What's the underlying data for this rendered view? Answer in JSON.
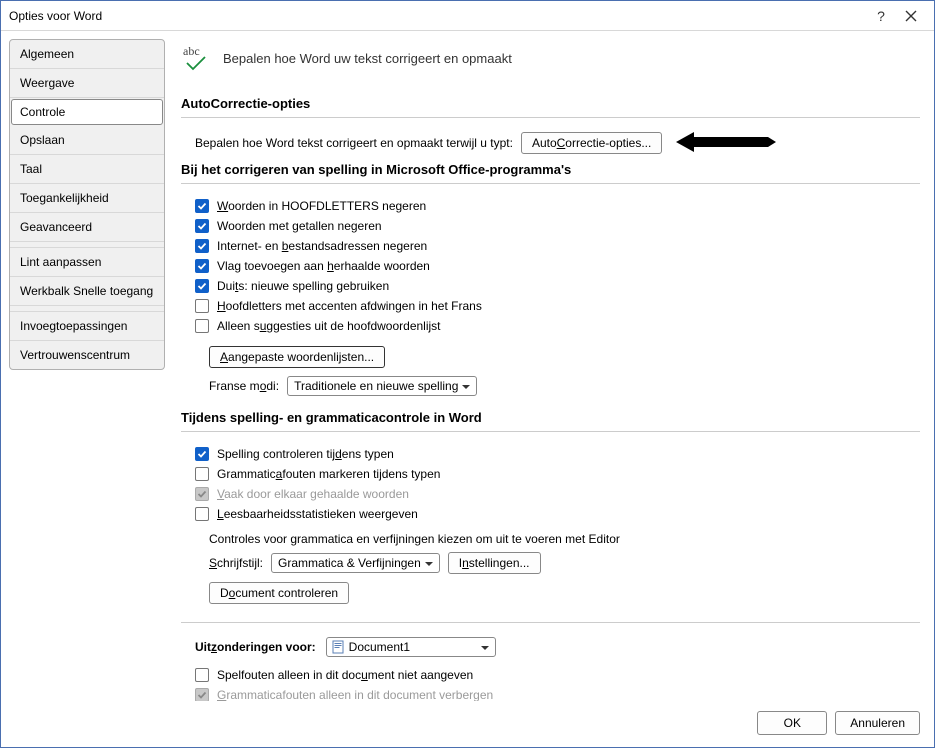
{
  "titlebar": {
    "title": "Opties voor Word"
  },
  "sidebar": {
    "items": [
      {
        "label": "Algemeen"
      },
      {
        "label": "Weergave"
      },
      {
        "label": "Controle",
        "selected": true
      },
      {
        "label": "Opslaan"
      },
      {
        "label": "Taal"
      },
      {
        "label": "Toegankelijkheid"
      },
      {
        "label": "Geavanceerd"
      },
      {
        "separator": true
      },
      {
        "label": "Lint aanpassen"
      },
      {
        "label": "Werkbalk Snelle toegang"
      },
      {
        "separator": true
      },
      {
        "label": "Invoegtoepassingen"
      },
      {
        "label": "Vertrouwenscentrum"
      }
    ]
  },
  "hero": {
    "text": "Bepalen hoe Word uw tekst corrigeert en opmaakt"
  },
  "section1": {
    "title": "AutoCorrectie-opties",
    "desc": "Bepalen hoe Word tekst corrigeert en opmaakt terwijl u typt:",
    "button": "AutoCorrectie-opties..."
  },
  "section2": {
    "title": "Bij het corrigeren van spelling in Microsoft Office-programma's",
    "checks": [
      {
        "pre": "",
        "u": "W",
        "post": "oorden in HOOFDLETTERS negeren",
        "checked": true
      },
      {
        "pre": "Woorden met ",
        "u": "g",
        "post": "etallen negeren",
        "checked": true
      },
      {
        "pre": "Internet- en ",
        "u": "b",
        "post": "estandsadressen negeren",
        "checked": true
      },
      {
        "pre": "Vlag toevoegen aan ",
        "u": "h",
        "post": "erhaalde woorden",
        "checked": true
      },
      {
        "pre": "Dui",
        "u": "t",
        "post": "s: nieuwe spelling gebruiken",
        "checked": true
      },
      {
        "pre": "",
        "u": "H",
        "post": "oofdletters met accenten afdwingen in het Frans",
        "checked": false
      },
      {
        "pre": "Alleen s",
        "u": "u",
        "post": "ggesties uit de hoofdwoordenlijst",
        "checked": false
      }
    ],
    "button": "Aangepaste woordenlijsten...",
    "modi_label": "Franse modi:",
    "modi_value": "Traditionele en nieuwe spelling"
  },
  "section3": {
    "title": "Tijdens spelling- en grammaticacontrole in Word",
    "checks": [
      {
        "pre": "Spelling controleren tij",
        "u": "d",
        "post": "ens typen",
        "checked": true
      },
      {
        "pre": "Grammatic",
        "u": "a",
        "post": "fouten markeren tijdens typen",
        "checked": false
      },
      {
        "pre": "",
        "u": "V",
        "post": "aak door elkaar gehaalde woorden",
        "checked": true,
        "disabled": true
      },
      {
        "pre": "",
        "u": "L",
        "post": "eesbaarheidsstatistieken weergeven",
        "checked": false
      }
    ],
    "subdesc": "Controles voor grammatica en verfijningen kiezen om uit te voeren met Editor",
    "style_label": "Schrijfstijl:",
    "style_value": "Grammatica & Verfijningen",
    "settings_button": "Instellingen...",
    "recheck_button": "Document controleren"
  },
  "section4": {
    "title_pre": "Uit",
    "title_u": "z",
    "title_post": "onderingen voor:",
    "doc_value": "Document1",
    "checks": [
      {
        "pre": "Spelfouten alleen in dit doc",
        "u": "u",
        "post": "ment niet aangeven",
        "checked": false
      },
      {
        "pre": "",
        "u": "G",
        "post": "rammaticafouten alleen in dit document verbergen",
        "checked": true,
        "disabled": true
      }
    ]
  },
  "footer": {
    "ok": "OK",
    "cancel": "Annuleren"
  }
}
